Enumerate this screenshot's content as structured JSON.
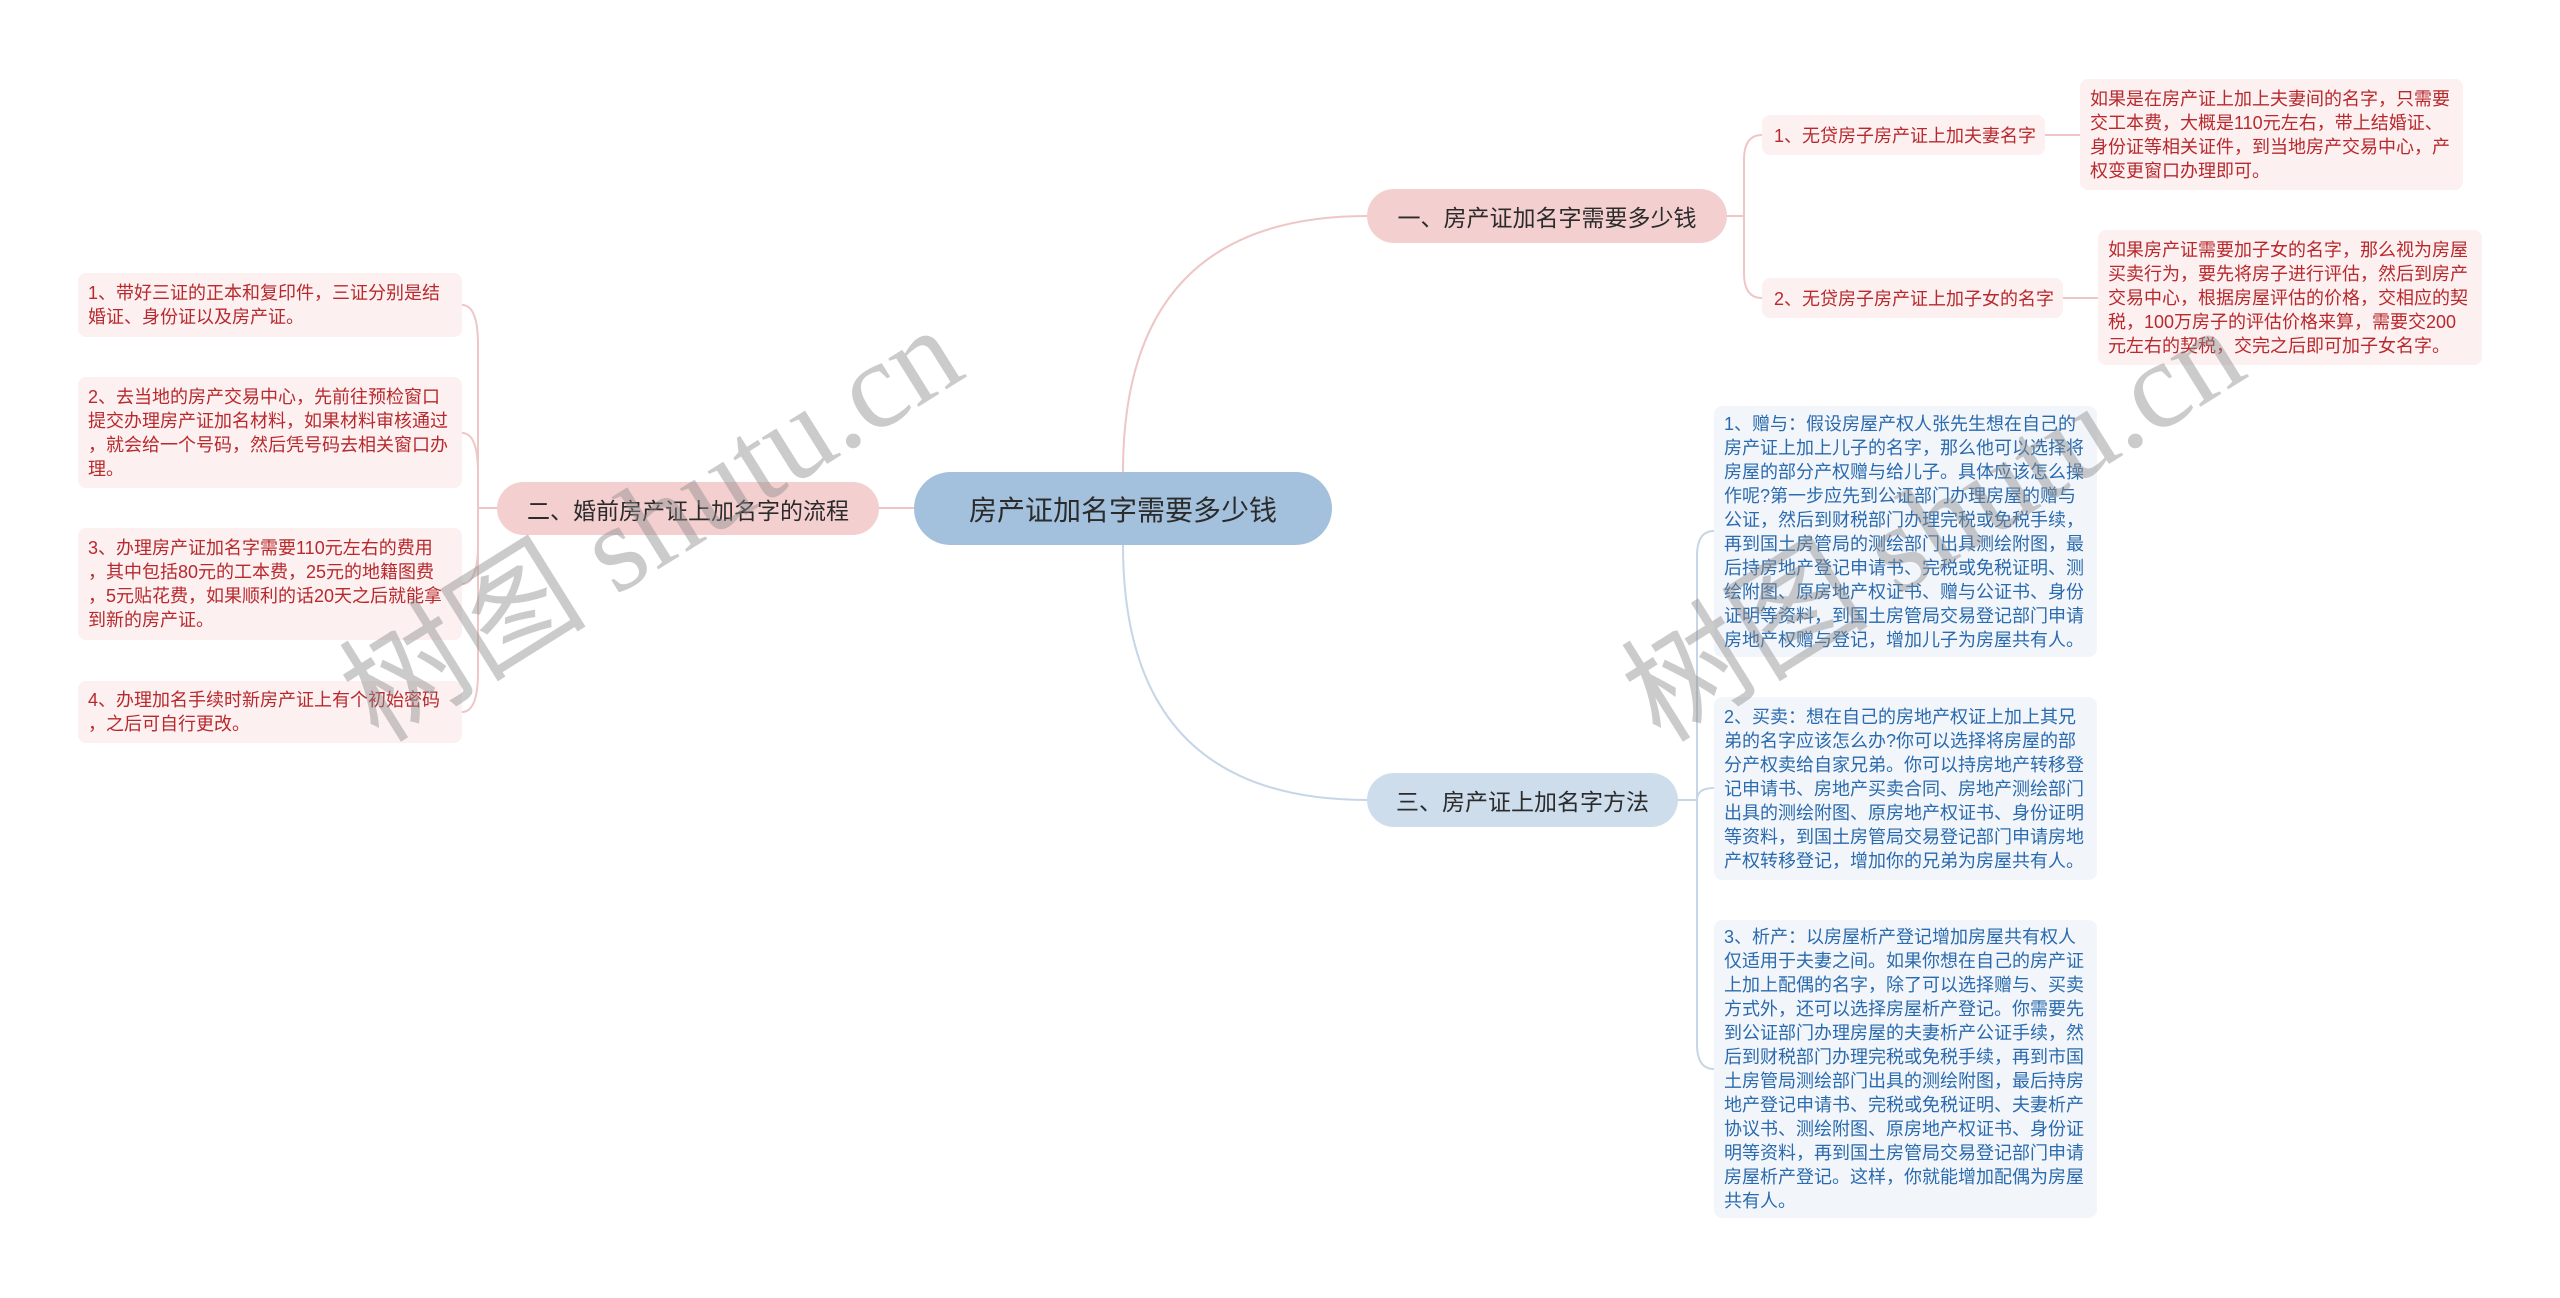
{
  "theme": {
    "root_fill": "#a3c0dc",
    "pink_branch_fill": "#f4cfcf",
    "blue_branch_fill": "#cdddec",
    "pink_leaf_fill": "#fcf0f0",
    "blue_leaf_fill": "#f2f6fb",
    "red_text": "#b8292d",
    "blue_text": "#2a6aae",
    "topic_text": "#2b2b2b",
    "pink_line": "#efc6c6",
    "blue_line": "#c6d6e7"
  },
  "mindmap": {
    "root": "房产证加名字需要多少钱",
    "branches": [
      {
        "label": "一、房产证加名字需要多少钱",
        "children": [
          {
            "label": "1、无贷房子房产证上加夫妻名字",
            "note_lines": [
              "如果是在房产证上加上夫妻间的名字，只需要",
              "交工本费，大概是110元左右，带上结婚证、",
              "身份证等相关证件，到当地房产交易中心，产",
              "权变更窗口办理即可。"
            ]
          },
          {
            "label": "2、无贷房子房产证上加子女的名字",
            "note_lines": [
              "如果房产证需要加子女的名字，那么视为房屋",
              "买卖行为，要先将房子进行评估，然后到房产",
              "交易中心，根据房屋评估的价格，交相应的契",
              "税，100万房子的评估价格来算，需要交200",
              "元左右的契税，交完之后即可加子女名字。"
            ]
          }
        ]
      },
      {
        "label": "二、婚前房产证上加名字的流程",
        "children": [
          {
            "lines": [
              "1、带好三证的正本和复印件，三证分别是结",
              "婚证、身份证以及房产证。"
            ]
          },
          {
            "lines": [
              "2、去当地的房产交易中心，先前往预检窗口",
              "提交办理房产证加名材料，如果材料审核通过",
              "，就会给一个号码，然后凭号码去相关窗口办",
              "理。"
            ]
          },
          {
            "lines": [
              "3、办理房产证加名字需要110元左右的费用",
              "，其中包括80元的工本费，25元的地籍图费",
              "，5元贴花费，如果顺利的话20天之后就能拿",
              "到新的房产证。"
            ]
          },
          {
            "lines": [
              "4、办理加名手续时新房产证上有个初始密码",
              "，之后可自行更改。"
            ]
          }
        ]
      },
      {
        "label": "三、房产证上加名字方法",
        "children": [
          {
            "lines": [
              "1、赠与：假设房屋产权人张先生想在自己的",
              "房产证上加上儿子的名字，那么他可以选择将",
              "房屋的部分产权赠与给儿子。具体应该怎么操",
              "作呢?第一步应先到公证部门办理房屋的赠与",
              "公证，然后到财税部门办理完税或免税手续，",
              "再到国土房管局的测绘部门出具测绘附图，最",
              "后持房地产登记申请书、完税或免税证明、测",
              "绘附图、原房地产权证书、赠与公证书、身份",
              "证明等资料，到国土房管局交易登记部门申请",
              "房地产权赠与登记，增加儿子为房屋共有人。"
            ]
          },
          {
            "lines": [
              "2、买卖：想在自己的房地产权证上加上其兄",
              "弟的名字应该怎么办?你可以选择将房屋的部",
              "分产权卖给自家兄弟。你可以持房地产转移登",
              "记申请书、房地产买卖合同、房地产测绘部门",
              "出具的测绘附图、原房地产权证书、身份证明",
              "等资料，到国土房管局交易登记部门申请房地",
              "产权转移登记，增加你的兄弟为房屋共有人。"
            ]
          },
          {
            "lines": [
              "3、析产：以房屋析产登记增加房屋共有权人",
              "仅适用于夫妻之间。如果你想在自己的房产证",
              "上加上配偶的名字，除了可以选择赠与、买卖",
              "方式外，还可以选择房屋析产登记。你需要先",
              "到公证部门办理房屋的夫妻析产公证手续，然",
              "后到财税部门办理完税或免税手续，再到市国",
              "土房管局测绘部门出具的测绘附图，最后持房",
              "地产登记申请书、完税或免税证明、夫妻析产",
              "协议书、测绘附图、原房地产权证书、身份证",
              "明等资料，再到国土房管局交易登记部门申请",
              "房屋析产登记。这样，你就能增加配偶为房屋",
              "共有人。"
            ]
          }
        ]
      }
    ]
  },
  "watermark": "树图 shutu.cn"
}
